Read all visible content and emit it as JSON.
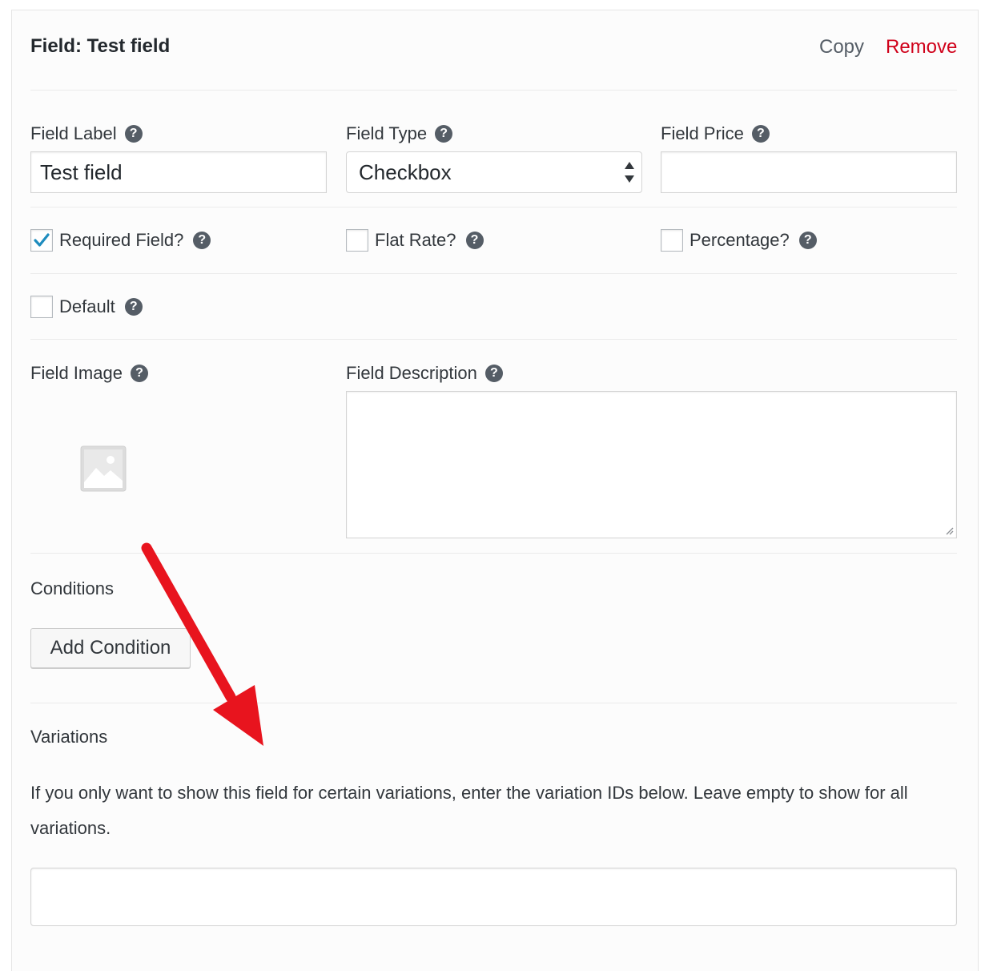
{
  "header": {
    "title": "Field: Test field",
    "copy_label": "Copy",
    "remove_label": "Remove"
  },
  "fields": {
    "field_label": {
      "label": "Field Label",
      "value": "Test field"
    },
    "field_type": {
      "label": "Field Type",
      "selected": "Checkbox"
    },
    "field_price": {
      "label": "Field Price",
      "value": ""
    }
  },
  "checkboxes": {
    "required": {
      "label": "Required Field?",
      "checked": true
    },
    "flat_rate": {
      "label": "Flat Rate?",
      "checked": false
    },
    "percentage": {
      "label": "Percentage?",
      "checked": false
    },
    "default": {
      "label": "Default",
      "checked": false
    }
  },
  "image": {
    "label": "Field Image",
    "icon": "image-placeholder-icon"
  },
  "description": {
    "label": "Field Description",
    "value": ""
  },
  "conditions": {
    "heading": "Conditions",
    "button_label": "Add Condition"
  },
  "variations": {
    "heading": "Variations",
    "help_text": "If you only want to show this field for certain variations, enter the variation IDs below. Leave empty to show for all variations.",
    "value": ""
  },
  "help_icon_glyph": "?",
  "colors": {
    "remove_link": "#d0021b",
    "annotation_arrow": "#e8141e",
    "checkmark": "#1e8cbe"
  }
}
